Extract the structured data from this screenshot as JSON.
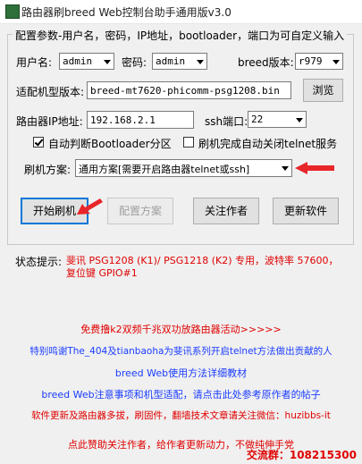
{
  "window": {
    "title": "路由器刷breed Web控制台助手通用版v3.0"
  },
  "group": {
    "title": "配置参数-用户名，密码，IP地址，bootloader，端口为可自定义输入"
  },
  "form": {
    "username_label": "用户名:",
    "username_value": "admin",
    "password_label": "密码:",
    "password_value": "admin",
    "breed_version_label": "breed版本:",
    "breed_version_value": "r979",
    "firmware_label": "适配机型版本:",
    "firmware_value": "breed-mt7620-phicomm-psg1208.bin",
    "browse_label": "浏览",
    "ip_label": "路由器IP地址:",
    "ip_value": "192.168.2.1",
    "ssh_port_label": "ssh端口:",
    "ssh_port_value": "22",
    "auto_detect_label": "自动判断Bootloader分区",
    "auto_detect_checked": true,
    "auto_close_telnet_label": "刷机完成自动关闭telnet服务",
    "auto_close_telnet_checked": false,
    "scheme_label": "刷机方案:",
    "scheme_value": "通用方案[需要开启路由器telnet或ssh]"
  },
  "buttons": {
    "start": "开始刷机",
    "configure": "配置方案",
    "follow": "关注作者",
    "update": "更新软件"
  },
  "status": {
    "label": "状态提示:",
    "line1": "斐讯 PSG1208 (K1)/ PSG1218 (K2) 专用，波特率 57600，",
    "line2": "复位键 GPIO#1"
  },
  "links": [
    "免费撸k2双频千兆双功放路由器活动>>>>>",
    "特别鸣谢The_404及tianbaoha为斐讯系列开启telnet方法做出贡献的人",
    "breed Web使用方法详细教材",
    "breed Web注意事项和机型适配，请点击此处参考原作者的帖子",
    "软件更新及路由器多拔，刷固件，翻墙技术文章请关注微信：huzibbs-it",
    "点此赞助关注作者，给作者更新动力，不做纯伸手党"
  ],
  "watermark": "交流群：108215300",
  "colors": {
    "red": "#e00000",
    "blue": "#1a3cff",
    "accent": "#0078d7"
  }
}
